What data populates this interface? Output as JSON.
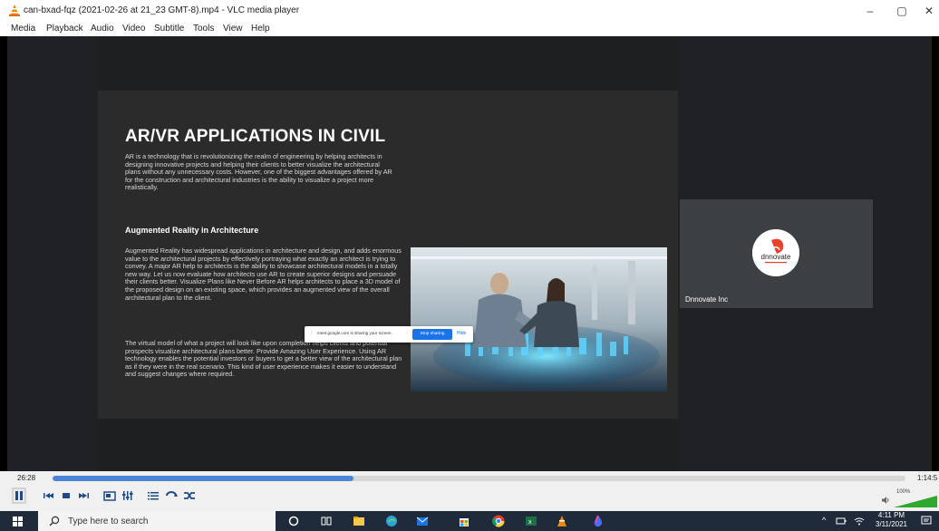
{
  "window": {
    "title": "can-bxad-fqz (2021-02-26 at 21_23 GMT-8).mp4 - VLC media player",
    "controls": {
      "minimize": "–",
      "maximize": "▢",
      "close": "✕"
    }
  },
  "menubar": [
    "Media",
    "Playback",
    "Audio",
    "Video",
    "Subtitle",
    "Tools",
    "View",
    "Help"
  ],
  "slide": {
    "title": "AR/VR APPLICATIONS IN CIVIL",
    "intro": "AR is a technology that is revolutionizing the realm of engineering by helping architects in designing innovative projects and helping their clients to better visualize the architectural plans without any unnecessary costs. However, one of the biggest advantages offered by AR for the construction and architectural industries is the ability to visualize a project more realistically.",
    "subheading": "Augmented Reality in Architecture",
    "para2": "Augmented Reality has widespread applications in architecture and design, and adds enormous value to the architectural projects by effectively portraying what exactly an architect is trying to convey. A major AR help to architects is the ability to showcase architectural models in a totally new way. Let us now evaluate how architects use AR to create superior designs and persuade their clients better. Visualize Plans like Never Before AR helps architects to place a 3D model of the proposed design on an existing space, which provides an augmented view of the overall architectural plan to the client.",
    "para3": "The virtual model of what a project will look like upon completion helps clients and potential prospects visualize architectural plans better. Provide Amazing User Experience. Using AR technology enables the potential investors or buyers to get a better view of the architectural plan as if they were in the real scenario. This kind of user experience makes it easier to understand and suggest changes where required."
  },
  "share_bar": {
    "message": "meet.google.com is sharing your screen.",
    "stop_label": "Stop sharing",
    "hide_label": "Hide"
  },
  "participant": {
    "name": "Dnnovate Inc",
    "logo_text": "dnnovate"
  },
  "player": {
    "elapsed": "26:28",
    "total": "1:14:5",
    "progress": 0.353,
    "volume": "100%",
    "accent": "#4c86d8"
  },
  "taskbar": {
    "search_placeholder": "Type here to search",
    "time": "4:11 PM",
    "date": "3/11/2021"
  }
}
